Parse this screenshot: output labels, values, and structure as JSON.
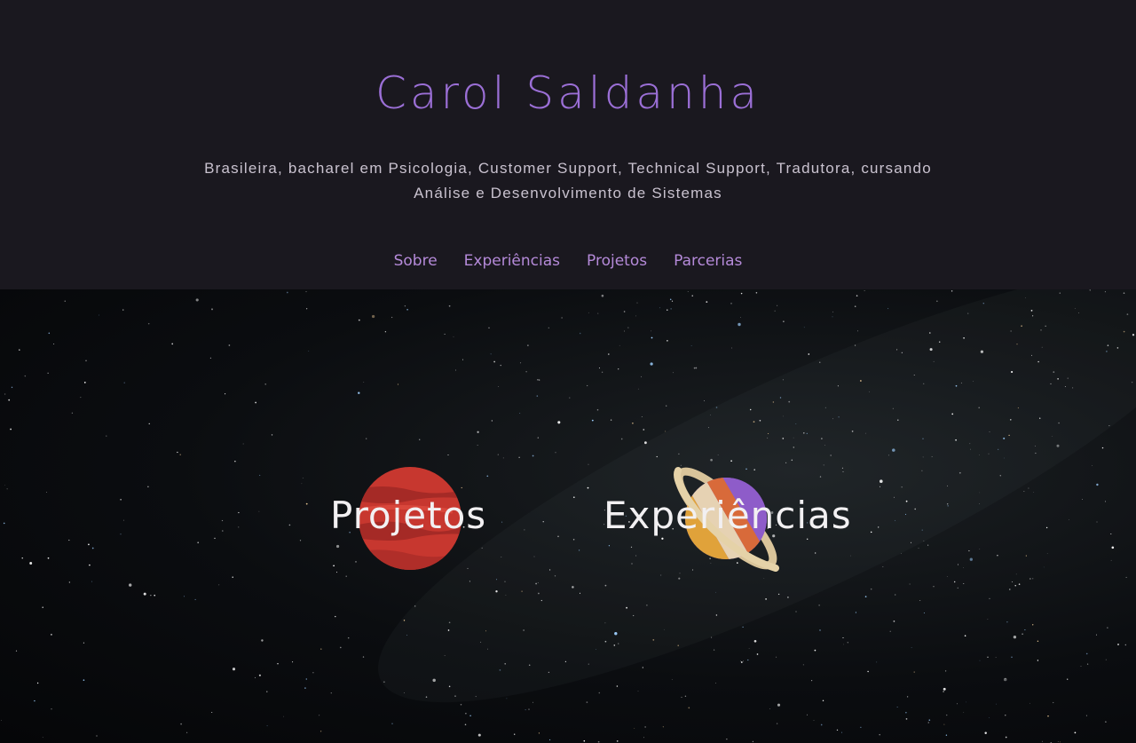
{
  "header": {
    "title": "Carol Saldanha",
    "tagline_line1": "Brasileira, bacharel em Psicologia, Customer Support, Technical Support, Tradutora, cursando",
    "tagline_line2": "Análise e Desenvolvimento de Sistemas"
  },
  "nav": {
    "items": [
      {
        "label": "Sobre"
      },
      {
        "label": "Experiências"
      },
      {
        "label": "Projetos"
      },
      {
        "label": "Parcerias"
      }
    ]
  },
  "hero": {
    "links": [
      {
        "label": "Projetos",
        "icon": "mars-planet-icon"
      },
      {
        "label": "Experiências",
        "icon": "saturn-planet-icon"
      }
    ]
  },
  "colors": {
    "background": "#1a181f",
    "title": "#9b6fd6",
    "nav": "#b58ad9",
    "tagline": "#c9c2cf"
  }
}
